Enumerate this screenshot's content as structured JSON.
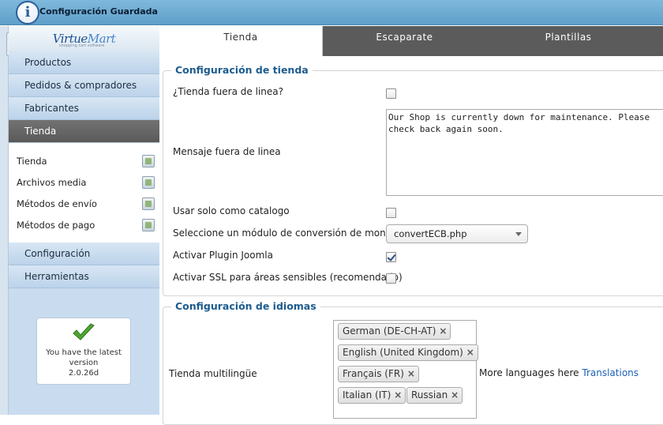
{
  "notification": {
    "title": "Configuración Guardada",
    "icon": "info-icon"
  },
  "sidebar": {
    "logo": {
      "text_primary": "Virtue",
      "text_secondary": "Mart",
      "tagline": "shopping cart software"
    },
    "items": [
      {
        "label": "Productos"
      },
      {
        "label": "Pedidos & compradores"
      },
      {
        "label": "Fabricantes"
      },
      {
        "label": "Tienda"
      },
      {
        "label": "Configuración"
      },
      {
        "label": "Herramientas"
      }
    ],
    "subitems": [
      {
        "label": "Tienda",
        "icon": "store-icon"
      },
      {
        "label": "Archivos media",
        "icon": "media-icon"
      },
      {
        "label": "Métodos de envío",
        "icon": "truck-icon"
      },
      {
        "label": "Métodos de pago",
        "icon": "payment-icon"
      }
    ],
    "version": {
      "line1": "You have the latest",
      "line2": "version",
      "line3": "2.0.26d"
    }
  },
  "tabs": [
    {
      "label": "Tienda"
    },
    {
      "label": "Escaparate"
    },
    {
      "label": "Plantillas"
    }
  ],
  "shop_config": {
    "legend": "Configuración de tienda",
    "offline_label": "¿Tienda fuera de linea?",
    "offline_message_label": "Mensaje fuera de linea",
    "offline_message_value": "Our Shop is currently down for maintenance. Please\ncheck back again soon.",
    "catalog_label": "Usar solo como catalogo",
    "currency_label": "Seleccione un módulo de conversión de moneda",
    "currency_value": "convertECB.php",
    "joomla_plugin_label": "Activar Plugin Joomla",
    "ssl_label": "Activar SSL para áreas sensibles (recomendado)"
  },
  "language_config": {
    "legend": "Configuración de idiomas",
    "multilingual_label": "Tienda multilingüe",
    "languages": [
      "German (DE-CH-AT)",
      "English (United Kingdom)",
      "Français (FR)",
      "Italian (IT)",
      "Russian"
    ],
    "more_text": "More languages here",
    "more_link": "Translations"
  },
  "colors": {
    "accent": "#1d5c8e",
    "active_nav": "#5a5a5a",
    "link": "#1e62b6"
  }
}
